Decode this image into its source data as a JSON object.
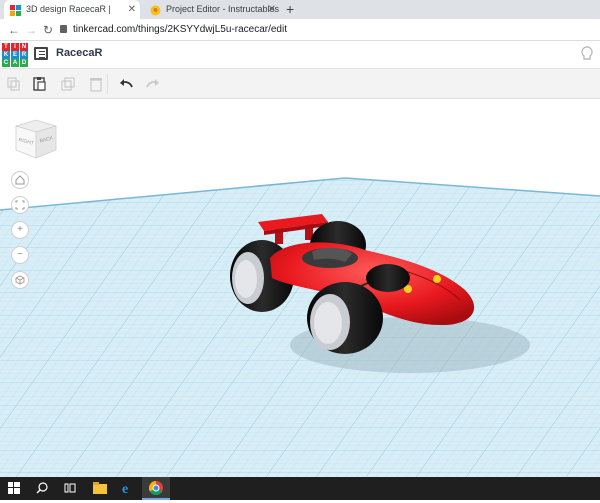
{
  "browser": {
    "tabs": [
      {
        "title": "3D design RacecaR | Tinkercad",
        "active": true
      },
      {
        "title": "Project Editor - Instructables",
        "active": false
      }
    ],
    "url": "tinkercad.com/things/2KSYYdwjL5u-racecar/edit"
  },
  "app": {
    "logo_letters": [
      "TIN",
      "KER",
      "CAD"
    ],
    "project_title": "RacecaR"
  },
  "viewcube": {
    "faces": [
      "RIGHT",
      "BACK"
    ]
  },
  "colors": {
    "grid_bg": "#d8eef7",
    "grid_line": "#9fcfe6",
    "car_body": "#e8191f",
    "tire": "#1a1a1a",
    "rim": "#c9ccd1",
    "yellow": "#f1d31c"
  }
}
